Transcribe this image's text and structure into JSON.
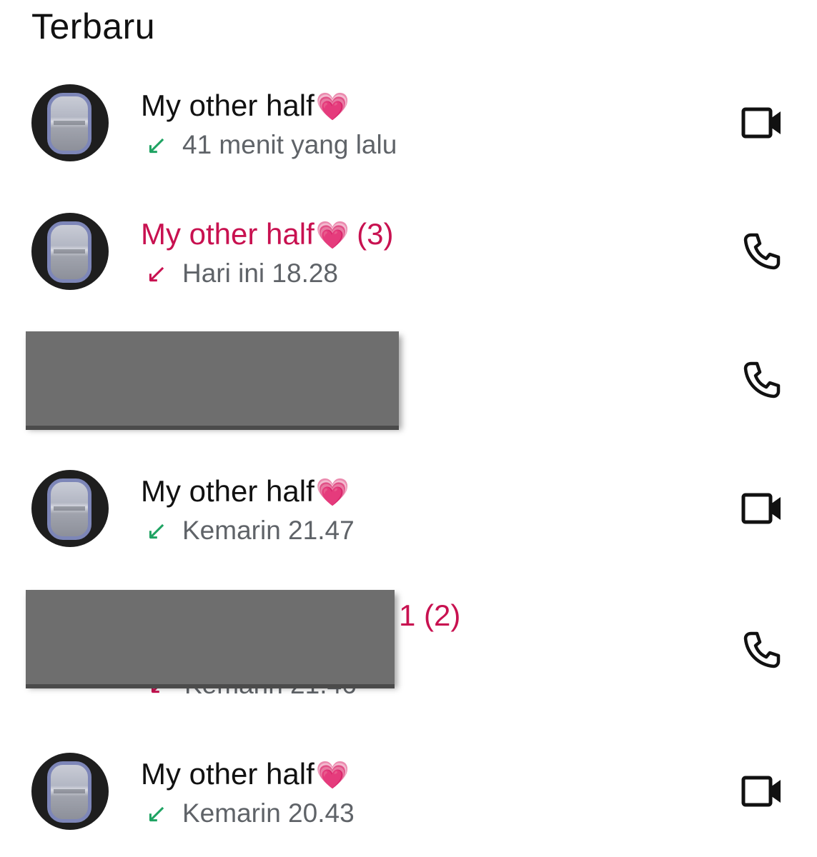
{
  "section_title": "Terbaru",
  "colors": {
    "missed": "#c81150",
    "incoming": "#1ea362",
    "text": "#111111",
    "secondary": "#5f6368"
  },
  "calls": [
    {
      "name": "My other half",
      "emoji": "💗",
      "count": "",
      "status": "41 menit yang lalu",
      "direction": "incoming",
      "type": "video",
      "missed": false
    },
    {
      "name": "My other half",
      "emoji": "💗",
      "count": "(3)",
      "status": "Hari ini 18.28",
      "direction": "missed",
      "type": "voice",
      "missed": true
    },
    {
      "name": "",
      "emoji": "",
      "count": "",
      "status": "",
      "direction": "",
      "type": "voice",
      "missed": false,
      "redacted": true
    },
    {
      "name": "My other half",
      "emoji": "💗",
      "count": "",
      "status": "Kemarin 21.47",
      "direction": "incoming",
      "type": "video",
      "missed": false
    },
    {
      "name_fragment": "1 (2)",
      "status_fragment": "Kemarin 21.46",
      "direction": "missed",
      "type": "voice",
      "missed": true,
      "redacted": true
    },
    {
      "name": "My other half",
      "emoji": "💗",
      "count": "",
      "status": "Kemarin 20.43",
      "direction": "incoming",
      "type": "video",
      "missed": false
    }
  ],
  "icons": {
    "incoming_arrow": "arrow-down-left-icon",
    "video": "video-camera-icon",
    "voice": "phone-icon"
  }
}
